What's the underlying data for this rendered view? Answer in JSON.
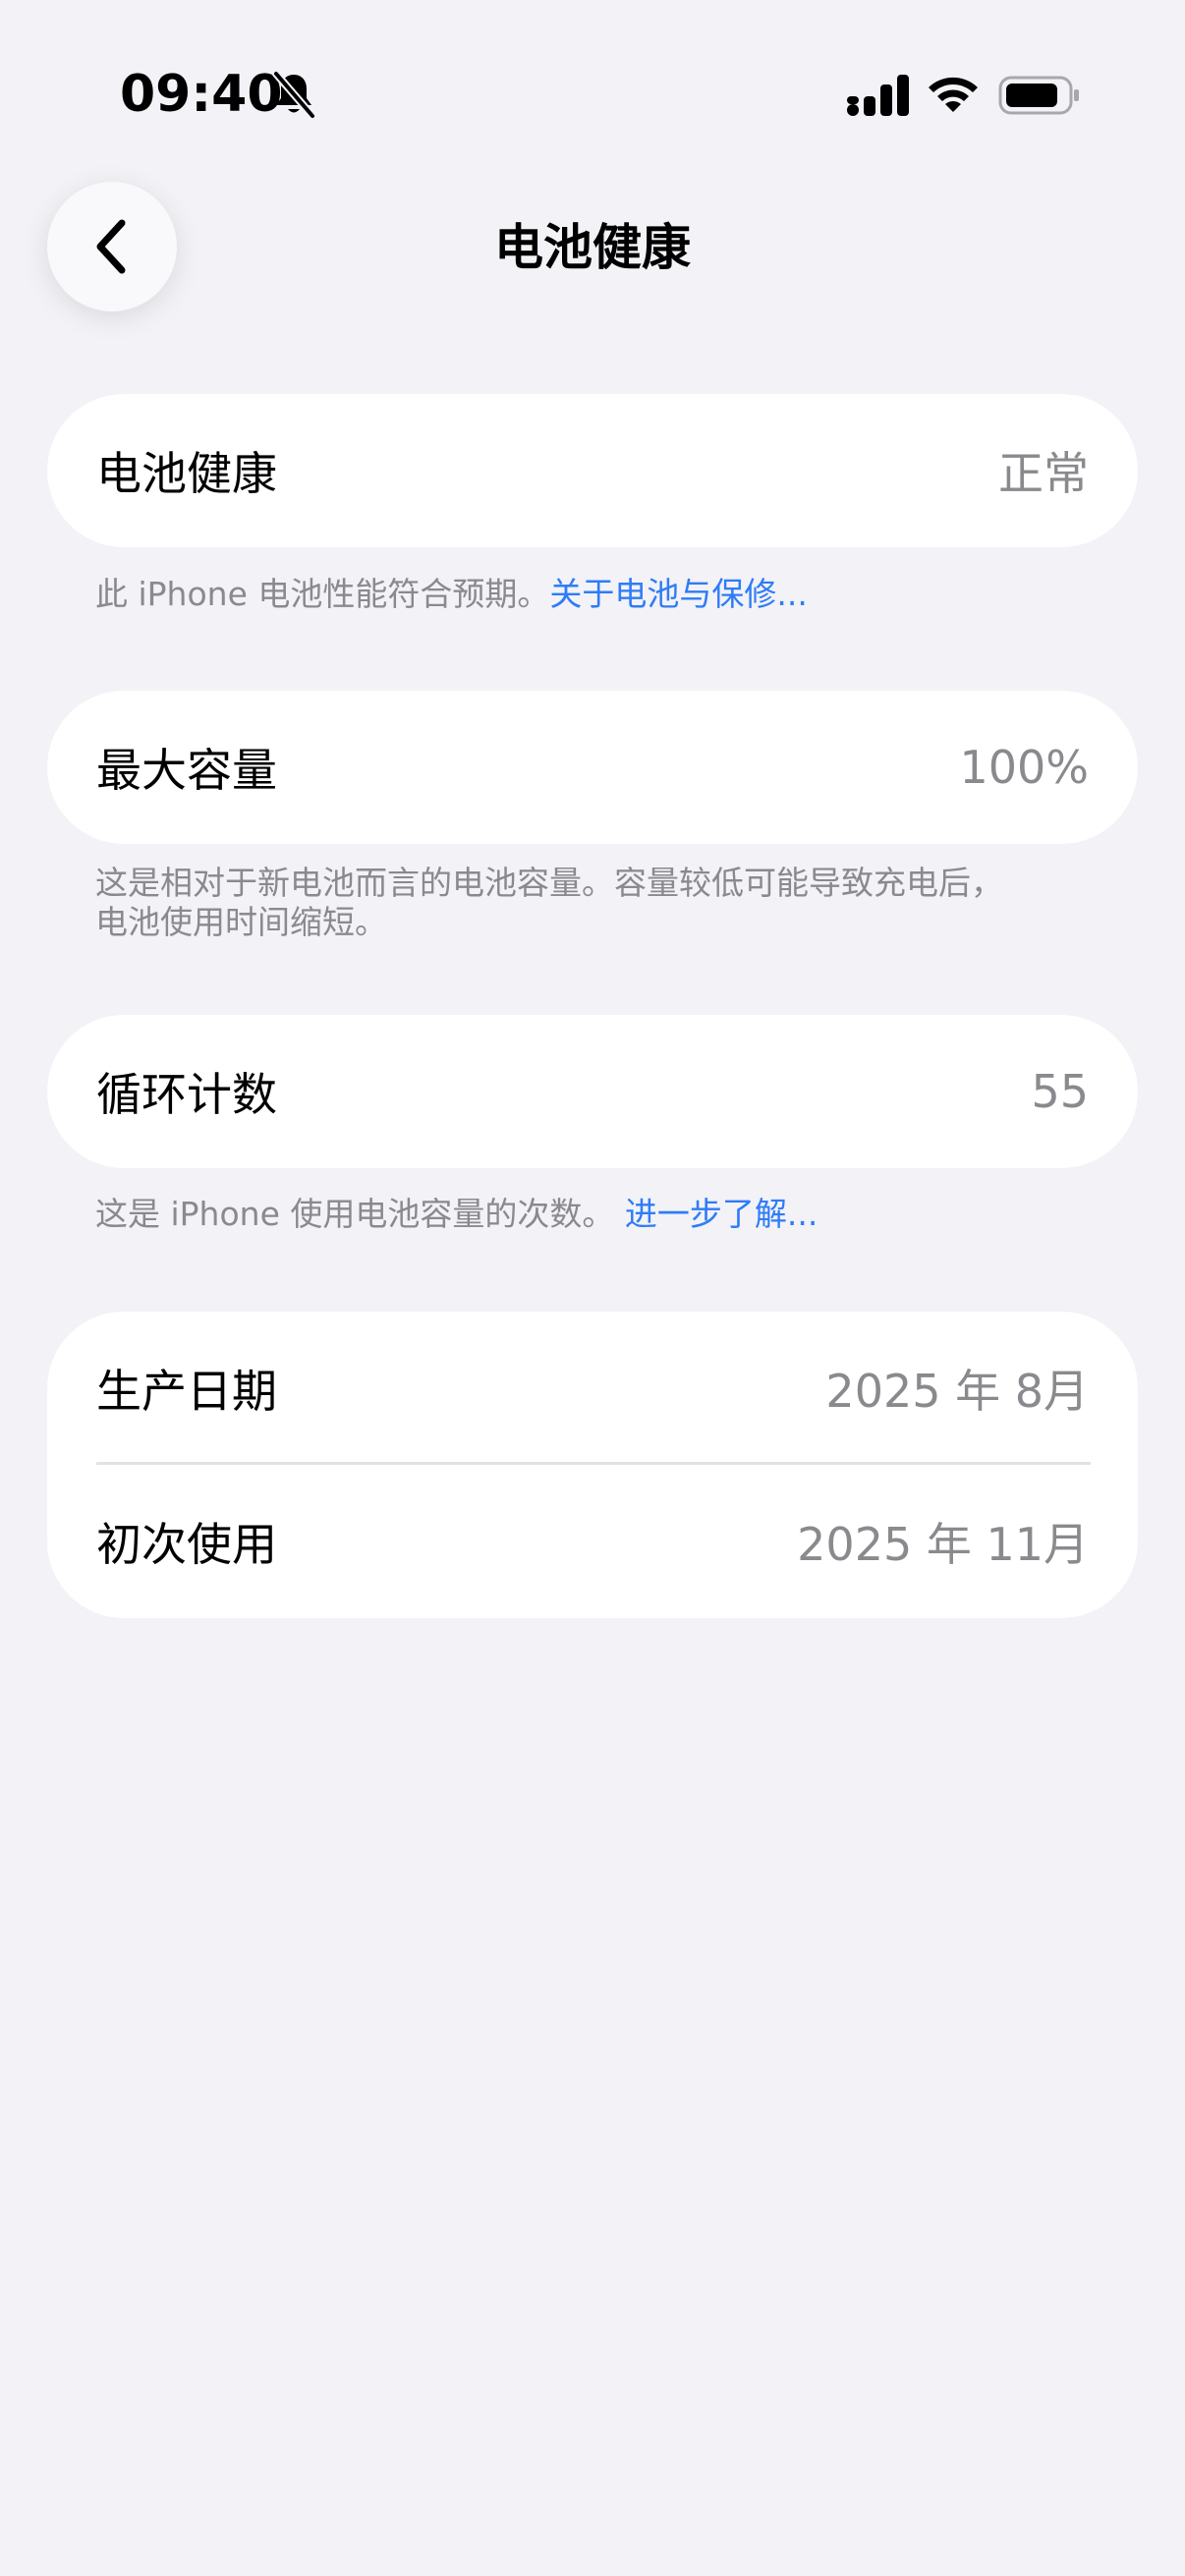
{
  "status_bar": {
    "time": "09:40",
    "icons": [
      "bell-slash-icon",
      "signal-icon",
      "wifi-icon",
      "battery-icon"
    ]
  },
  "nav": {
    "back_icon": "chevron-left-icon",
    "title": "电池健康"
  },
  "sections": {
    "health": {
      "label": "电池健康",
      "value": "正常",
      "note": "此 iPhone 电池性能符合预期。",
      "note_link": "关于电池与保修..."
    },
    "capacity": {
      "label": "最大容量",
      "value": "100%",
      "note_line1": "这是相对于新电池而言的电池容量。容量较低可能导致充电后，",
      "note_line2": "电池使用时间缩短。"
    },
    "cycles": {
      "label": "循环计数",
      "value": "55",
      "note": "这是 iPhone 使用电池容量的次数。 ",
      "note_link": "进一步了解..."
    },
    "dates": {
      "manufacture_label": "生产日期",
      "manufacture_value": "2025 年 8月",
      "first_use_label": "初次使用",
      "first_use_value": "2025 年 11月"
    }
  },
  "colors": {
    "background": "#f2f2f7",
    "card": "#ffffff",
    "secondary_text": "#8a8a8e",
    "link": "#2f7cf6"
  }
}
